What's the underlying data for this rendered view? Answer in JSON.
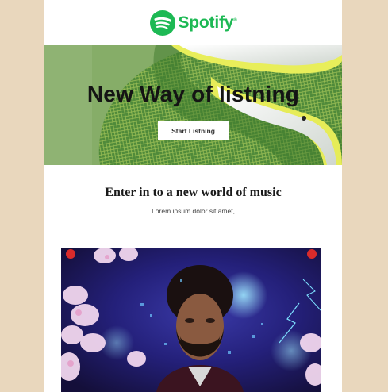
{
  "brand": {
    "name": "Spotify",
    "trademark": "®",
    "color": "#1db954"
  },
  "hero": {
    "title": "New Way of listning",
    "button_label": "Start Listning",
    "bg_color": "#7aa55a"
  },
  "intro": {
    "title": "Enter in to a new world of music",
    "subtitle": "Lorem ipsum dolor sit amet,"
  },
  "colors": {
    "page_bg": "#e9d7bd",
    "card_bg": "#ffffff"
  }
}
